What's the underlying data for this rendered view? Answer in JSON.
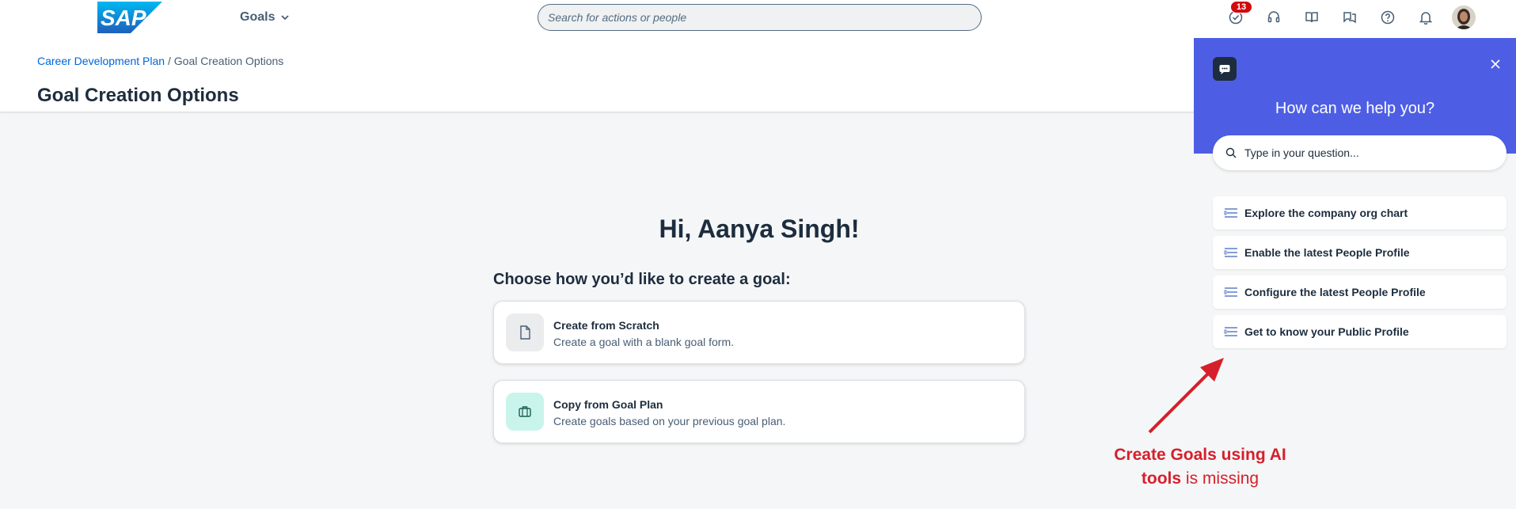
{
  "shellbar": {
    "logo_text": "SAP",
    "menu_label": "Goals",
    "search_placeholder": "Search for actions or people",
    "notification_count": "13"
  },
  "breadcrumb": {
    "parent": "Career Development Plan",
    "separator": "/",
    "current": "Goal Creation Options"
  },
  "page_title": "Goal Creation Options",
  "main": {
    "greeting": "Hi, Aanya Singh!",
    "choose_label": "Choose how you’d like to create a goal:",
    "options": [
      {
        "title": "Create from Scratch",
        "description": "Create a goal with a blank goal form.",
        "icon": "document-icon"
      },
      {
        "title": "Copy from Goal Plan",
        "description": "Create goals based on your previous goal plan.",
        "icon": "briefcase-icon"
      }
    ]
  },
  "help_panel": {
    "title": "How can we help you?",
    "search_placeholder": "Type in your question...",
    "items": [
      "Explore the company org chart",
      "Enable the latest People Profile",
      "Configure the latest People Profile",
      "Get to know your Public Profile"
    ]
  },
  "annotation": {
    "bold_text": "Create Goals using AI tools",
    "rest_text": "is missing"
  },
  "colors": {
    "brand_blue": "#0064d9",
    "help_hero": "#4e5ee4",
    "annotation_red": "#d5202b",
    "badge_red": "#d20a0a"
  }
}
